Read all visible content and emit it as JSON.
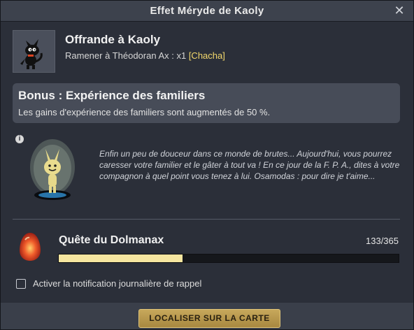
{
  "window": {
    "title": "Effet Méryde de Kaoly",
    "close_label": "✕"
  },
  "quest": {
    "title": "Offrande à Kaoly",
    "subtitle_prefix": "Ramener à Théodoran Ax : x1 ",
    "subtitle_tag": "[Chacha]"
  },
  "bonus": {
    "title": "Bonus : Expérience des familiers",
    "description": "Les gains d'expérience des familiers sont augmentés de 50 %."
  },
  "info_icon_label": "i",
  "lore": "Enfin un peu de douceur dans ce monde de brutes... Aujourd'hui, vous pourrez caresser votre familier et le gâter à tout va ! En ce jour de la F. P. A., dites à votre compagnon à quel point vous tenez à lui. Osamodas : pour dire je t'aime...",
  "dofus": {
    "title": "Quête du Dolmanax",
    "count_text": "133/365",
    "progress_fraction": 0.3644
  },
  "reminder": {
    "label": "Activer la notification journalière de rappel",
    "checked": false
  },
  "footer": {
    "locate_label": "LOCALISER SUR LA CARTE"
  },
  "colors": {
    "accent_gold": "#f3d86c",
    "progress": "#f6e6a0",
    "button": "#b8984c"
  }
}
